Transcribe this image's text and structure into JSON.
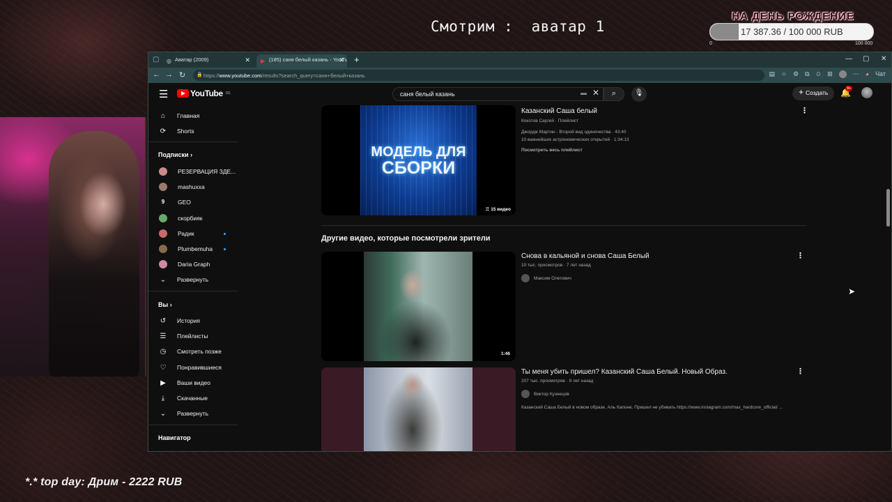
{
  "overlay": {
    "stream_title": "Смотрим :  аватар 1",
    "goal_title": "НА ДЕНЬ РОЖДЕНИЕ",
    "goal_progress_text": "17 387.36 / 100 000 RUB",
    "goal_progress_fraction": 0.174,
    "goal_min": "0",
    "goal_max": "100 000",
    "top_day": "*.* top day: Дрим - 2222 RUB"
  },
  "browser": {
    "tabs": [
      {
        "label": "Аватар (2009)",
        "active": false
      },
      {
        "label": "(185) саня белый казань - YouTube",
        "active": true
      }
    ],
    "url_scheme": "https://",
    "url_host": "www.youtube.com",
    "url_rest": "/results?search_query=саня+белый+казань",
    "chat_label": "Чат"
  },
  "youtube": {
    "logo_text": "YouTube",
    "logo_region": "DE",
    "search_value": "саня белый казань",
    "create_label": "Создать",
    "notifications_badge": "9+",
    "sidebar": {
      "main_items": [
        {
          "icon": "home-icon",
          "label": "Главная"
        },
        {
          "icon": "shorts-icon",
          "label": "Shorts"
        }
      ],
      "subscriptions_header": "Подписки",
      "subscriptions": [
        {
          "label": "РЕЗЕРВАЦИЯ ЗДЕ...",
          "color": "#c98a8a",
          "new": false
        },
        {
          "label": "mashuxxa",
          "color": "#9a7a6a",
          "new": false
        },
        {
          "label": "GEO",
          "color": "#111111",
          "new": false
        },
        {
          "label": "скорбияк",
          "color": "#6aa86a",
          "new": false
        },
        {
          "label": "Радик",
          "color": "#c76b6b",
          "new": true
        },
        {
          "label": "Plumbemuha",
          "color": "#8a6a4a",
          "new": true
        },
        {
          "label": "Daria Graph",
          "color": "#d08aa0",
          "new": false
        }
      ],
      "expand_label": "Развернуть",
      "you_header": "Вы",
      "you_items": [
        {
          "icon": "history-icon",
          "label": "История"
        },
        {
          "icon": "playlists-icon",
          "label": "Плейлисты"
        },
        {
          "icon": "watch-later-icon",
          "label": "Смотреть позже"
        },
        {
          "icon": "like-icon",
          "label": "Понравившиеся"
        },
        {
          "icon": "your-videos-icon",
          "label": "Ваши видео"
        },
        {
          "icon": "downloads-icon",
          "label": "Скачанные"
        },
        {
          "icon": "expand-icon",
          "label": "Развернуть"
        }
      ],
      "navigator_header": "Навигатор"
    },
    "results": {
      "playlist": {
        "thumb_line1": "МОДЕЛЬ ДЛЯ",
        "thumb_line2": "СБОРКИ",
        "count": "15 видео",
        "title": "Казанский Саша белый",
        "meta": "Кокотов Сергей · Плейлист",
        "item1": "Джордж Мартин - Второй вид одиночества · 43:40",
        "item2": "10 важнейших астрономических открытий · 1:34:13",
        "view_all": "Посмотреть весь плейлист"
      },
      "section_title": "Другие видео, которые посмотрели зрители",
      "videos": [
        {
          "title": "Снова в кальяной и снова Саша Белый",
          "meta": "10 тыс. просмотров · 7 лет назад",
          "channel": "Максим Олегович",
          "duration": "1:46",
          "description": ""
        },
        {
          "title": "Ты меня убить пришел? Казанский Саша Белый. Новый Образ.",
          "meta": "207 тыс. просмотров · 9 лет назад",
          "channel": "Виктор Кузнецов",
          "duration": "",
          "description": "Казанский Саша Белый в новом образе, Аль Капоне. Пришел не убивать https://www.instagram.com/max_hardcore_official/ ..."
        }
      ]
    }
  }
}
